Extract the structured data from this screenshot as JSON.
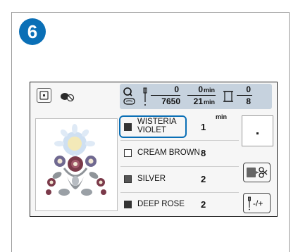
{
  "step": {
    "number": "6"
  },
  "status": {
    "total_stitches": "7650",
    "stitches_done": "0",
    "time_total_min": "21",
    "time_elapsed_min": "0",
    "min_unit": "min",
    "color_count": "8",
    "color_current": "0"
  },
  "colors": [
    {
      "name": "WISTERIA VIOLET",
      "name_line1": "WISTERIA",
      "name_line2": "VIOLET",
      "number": "1",
      "unit": "min",
      "swatch": "#7a6f96",
      "selected": true
    },
    {
      "name": "CREAM BROWN",
      "number": "8",
      "swatch": "#f4ead8",
      "selected": false
    },
    {
      "name": "SILVER",
      "number": "2",
      "swatch": "#9aa0a6",
      "selected": false
    },
    {
      "name": "DEEP ROSE",
      "number": "2",
      "swatch": "#7b3a4a",
      "selected": false
    }
  ],
  "buttons": {
    "adjust_label": "-/+"
  },
  "theme": {
    "accent": "#0a6fb6",
    "status_bar_bg": "#c6d2de",
    "panel_bg": "#f6f6f6"
  }
}
